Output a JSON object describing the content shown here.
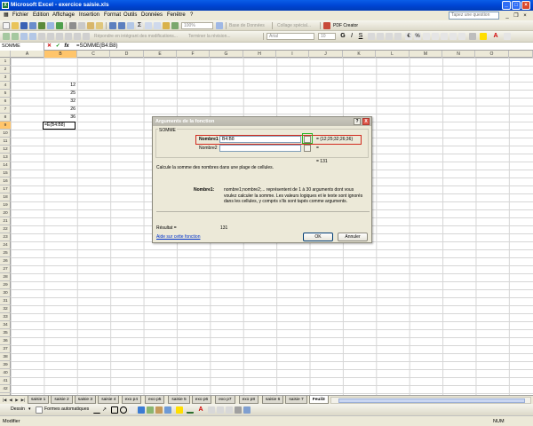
{
  "window": {
    "title": "Microsoft Excel - exercice saisie.xls",
    "app_icon": "excel-icon"
  },
  "menu": {
    "items": [
      "Fichier",
      "Edition",
      "Affichage",
      "Insertion",
      "Format",
      "Outils",
      "Données",
      "Fenêtre",
      "?"
    ],
    "help_placeholder": "Tapez une question"
  },
  "toolbar": {
    "base_de_donnees": "Base de Données",
    "collage_special": "Collage spécial...",
    "pdf_creator": "PDF Creator",
    "zoom": "100%",
    "font": "Arial",
    "font_size": "10",
    "reply_changes": "Répondre en intégrant des modifications...",
    "end_review": "Terminer la révision..."
  },
  "formula_bar": {
    "name_box": "SOMME",
    "fx": "fx",
    "formula": "=SOMME(B4:B8)"
  },
  "columns": [
    "A",
    "B",
    "C",
    "D",
    "E",
    "F",
    "G",
    "H",
    "I",
    "J",
    "K",
    "L",
    "M",
    "N",
    "O"
  ],
  "rows": [
    "1",
    "2",
    "3",
    "4",
    "5",
    "6",
    "7",
    "8",
    "9",
    "10",
    "11",
    "12",
    "13",
    "14",
    "15",
    "16",
    "17",
    "18",
    "19",
    "20",
    "21",
    "22",
    "23",
    "24",
    "25",
    "26",
    "27",
    "28",
    "29",
    "30",
    "31",
    "32",
    "33",
    "34",
    "35",
    "36",
    "37",
    "38",
    "39",
    "40",
    "41",
    "42"
  ],
  "cells": {
    "B4": "12",
    "B5": "25",
    "B6": "32",
    "B7": "26",
    "B8": "36",
    "B9": "=E(B4:B8)"
  },
  "dialog": {
    "title": "Arguments de la fonction",
    "group_label": "SOMME",
    "arg1_label": "Nombre1",
    "arg1_value": "B4:B8",
    "arg1_result": "= {12;25;32;26;36}",
    "arg2_label": "Nombre2",
    "arg2_result": "=",
    "total_result": "= 131",
    "description": "Calcule la somme des nombres dans une plage de cellules.",
    "param_label": "Nombre1:",
    "param_desc": "nombre1;nombre2;... représentent de 1 à 30 arguments dont vous voulez calculer la somme. Les valeurs logiques et le texte sont ignorés dans les cellules, y compris s'ils sont tapés comme arguments.",
    "result_label": "Résultat =",
    "result_value": "131",
    "help_link": "Aide sur cette fonction",
    "ok": "OK",
    "cancel": "Annuler",
    "help_btn": "?",
    "close_btn": "X"
  },
  "sheets": [
    "saisie 1",
    "saisie 2",
    "saisie 3",
    "saisie 4",
    "exo p4",
    "exo p5",
    "saisie 5",
    "exo p6",
    "exo p7",
    "exo p8",
    "saisie 6",
    "saisie 7",
    "Feuil3"
  ],
  "active_sheet": "Feuil3",
  "drawing": {
    "dessin": "Dessin",
    "formes": "Formes automatiques"
  },
  "status": {
    "mode": "Modifier",
    "num": "NUM"
  }
}
